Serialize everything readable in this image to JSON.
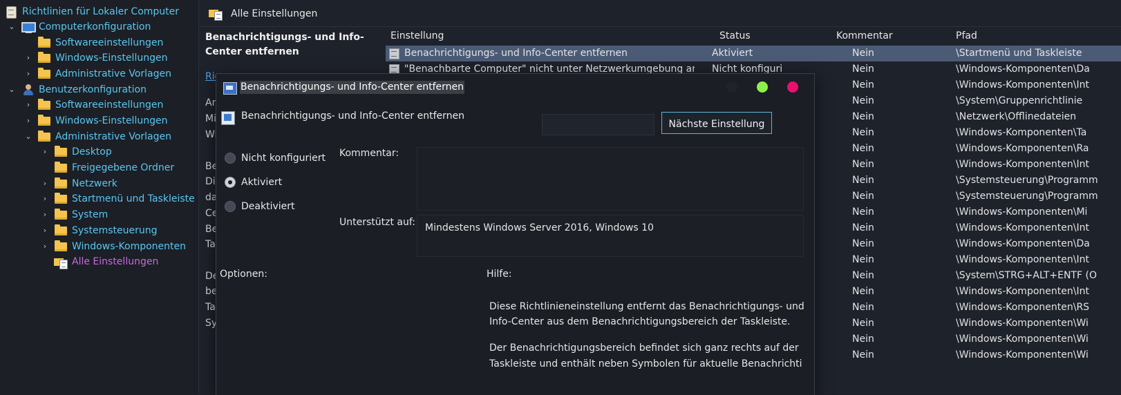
{
  "tree": {
    "root": "Richtlinien für Lokaler Computer",
    "computer_config": "Computerkonfiguration",
    "cc_software": "Softwareeinstellungen",
    "cc_windows": "Windows-Einstellungen",
    "cc_admin": "Administrative Vorlagen",
    "user_config": "Benutzerkonfiguration",
    "uc_software": "Softwareeinstellungen",
    "uc_windows": "Windows-Einstellungen",
    "uc_admin": "Administrative Vorlagen",
    "desktop": "Desktop",
    "shared_folders": "Freigegebene Ordner",
    "network": "Netzwerk",
    "start_taskbar": "Startmenü und Taskleiste",
    "system": "System",
    "control_panel": "Systemsteuerung",
    "windows_components": "Windows-Komponenten",
    "all_settings": "Alle Einstellungen"
  },
  "header": {
    "title": "Alle Einstellungen"
  },
  "desc": {
    "title": "Benachrichtigungs- und Info-Center entfernen",
    "link": "Ric",
    "lines1": [
      "An",
      "Mi",
      "Wi"
    ],
    "lines2": [
      "Be",
      "Di",
      "da",
      "Ce",
      "Be",
      "Ta"
    ],
    "lines3": [
      "De",
      "be",
      "Ta",
      "Sy"
    ]
  },
  "columns": {
    "setting": "Einstellung",
    "status": "Status",
    "comment": "Kommentar",
    "path": "Pfad"
  },
  "rows": [
    {
      "setting": "Benachrichtigungs- und Info-Center entfernen",
      "status": "Aktiviert",
      "comment": "Nein",
      "path": "\\Startmenü und Taskleiste"
    },
    {
      "setting": "\"Benachbarte Computer\" nicht unter Netzwerkumgebung anz",
      "status": "Nicht konfiguri",
      "comment": "Nein",
      "path": "\\Windows-Komponenten\\Da"
    },
    {
      "comment": "Nein",
      "path": "\\Windows-Komponenten\\Int"
    },
    {
      "comment": "Nein",
      "path": "\\System\\Gruppenrichtlinie"
    },
    {
      "comment": "Nein",
      "path": "\\Netzwerk\\Offlinedateien"
    },
    {
      "comment": "Nein",
      "path": "\\Windows-Komponenten\\Ta"
    },
    {
      "comment": "Nein",
      "path": "\\Windows-Komponenten\\Ra"
    },
    {
      "comment": "Nein",
      "path": "\\Windows-Komponenten\\Int"
    },
    {
      "comment": "Nein",
      "path": "\\Systemsteuerung\\Programm"
    },
    {
      "comment": "Nein",
      "path": "\\Systemsteuerung\\Programm"
    },
    {
      "comment": "Nein",
      "path": "\\Windows-Komponenten\\Mi"
    },
    {
      "comment": "Nein",
      "path": "\\Windows-Komponenten\\Int"
    },
    {
      "comment": "Nein",
      "path": "\\Windows-Komponenten\\Da"
    },
    {
      "comment": "Nein",
      "path": "\\Windows-Komponenten\\Int"
    },
    {
      "comment": "Nein",
      "path": "\\System\\STRG+ALT+ENTF (O"
    },
    {
      "comment": "Nein",
      "path": "\\Windows-Komponenten\\Int"
    },
    {
      "comment": "Nein",
      "path": "\\Windows-Komponenten\\RS"
    },
    {
      "comment": "Nein",
      "path": "\\Windows-Komponenten\\Wi"
    },
    {
      "comment": "Nein",
      "path": "\\Windows-Komponenten\\Wi"
    },
    {
      "comment": "Nein",
      "path": "\\Windows-Komponenten\\Wi"
    }
  ],
  "dialog": {
    "title": "Benachrichtigungs- und Info-Center entfernen",
    "heading": "Benachrichtigungs- und Info-Center entfernen",
    "next_button": "Nächste Einstellung",
    "radio_not_configured": "Nicht konfiguriert",
    "radio_enabled": "Aktiviert",
    "radio_disabled": "Deaktiviert",
    "selected_option": "Aktiviert",
    "comment_label": "Kommentar:",
    "supported_label": "Unterstützt auf:",
    "supported_value": "Mindestens Windows Server 2016, Windows 10",
    "options_label": "Optionen:",
    "help_label": "Hilfe:",
    "help_lines": [
      "Diese Richtlinieneinstellung entfernt das Benachrichtigungs- und",
      "Info-Center aus dem Benachrichtigungsbereich der Taskleiste.",
      "",
      "Der Benachrichtigungsbereich befindet sich ganz rechts auf der",
      "Taskleiste und enthält neben Symbolen für aktuelle Benachrichti"
    ]
  },
  "colors": {
    "tree_text": "#59c7f0",
    "tree_selected": "#c56bdc",
    "selected_row": "#4b5b76",
    "maximize_dot": "#8df04a",
    "close_dot": "#e8106f"
  }
}
